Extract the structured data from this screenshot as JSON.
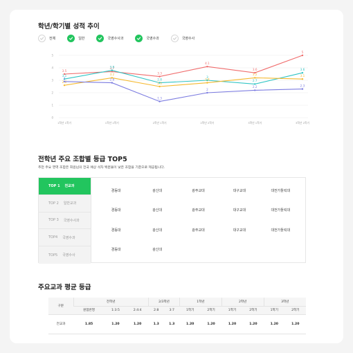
{
  "section1": {
    "title": "학년/학기별 성적 추이"
  },
  "filters": [
    {
      "label": "전체",
      "checked": false
    },
    {
      "label": "일반",
      "checked": true
    },
    {
      "label": "국영수사과",
      "checked": true
    },
    {
      "label": "국영수과",
      "checked": true
    },
    {
      "label": "국영수사",
      "checked": false
    }
  ],
  "chart_data": {
    "type": "line",
    "categories": [
      "1학년 1학기",
      "1학년 2학기",
      "2학년 1학기",
      "2학년 2학기",
      "3학년 1학기",
      "3학년 2학기"
    ],
    "ylim": [
      0,
      5
    ],
    "yticks": [
      0,
      1,
      2,
      3,
      4,
      5
    ],
    "ytick_labels": [
      "0",
      "1",
      "2",
      "3",
      "4",
      "5"
    ],
    "grid": true,
    "series": [
      {
        "color": "#f06c6c",
        "values": [
          3.5,
          3.7,
          3.3,
          4.1,
          3.6,
          5
        ],
        "labels": [
          "3.5",
          "3.7",
          "3.3",
          "4.1",
          "3.6",
          "5"
        ]
      },
      {
        "color": "#2ec4c4",
        "values": [
          3.1,
          3.8,
          2.8,
          3,
          2.7,
          3.6
        ],
        "labels": [
          "3.1",
          "3.8",
          "2.8",
          "3",
          "2.7",
          "3.6"
        ]
      },
      {
        "color": "#f5b82e",
        "values": [
          2.6,
          3.2,
          2.5,
          2.8,
          3.2,
          3.1
        ],
        "labels": [
          "2.6",
          "3.2",
          "2.5",
          "2.8",
          "3.2",
          "3.1"
        ]
      },
      {
        "color": "#7b7be0",
        "values": [
          2.9,
          2.8,
          1.3,
          2,
          2.2,
          2.3
        ],
        "labels": [
          "2",
          "2.8",
          "1.3",
          "2",
          "2.2",
          "2.3"
        ]
      }
    ]
  },
  "section2": {
    "title": "전학년 주요 조합별 등급 TOP5",
    "description": "추천 주요 영역 조합은 희원님의 전국 예상 석차 백분율이 낮은 조합을 기준으로 제공됩니다."
  },
  "top_tabs": [
    {
      "num": "TOP 1",
      "label": "전교과",
      "active": true
    },
    {
      "num": "TOP 2",
      "label": "일반교과",
      "active": false
    },
    {
      "num": "TOP 3",
      "label": "국영수사과",
      "active": false
    },
    {
      "num": "TOP4",
      "label": "국영수과",
      "active": false
    },
    {
      "num": "TOP5",
      "label": "국영수사",
      "active": false
    }
  ],
  "universities": [
    [
      "경동대",
      "광신대",
      "광주교대",
      "대구교대",
      "대전가톨릭대"
    ],
    [
      "경동대",
      "광신대",
      "광주교대",
      "대구교대",
      "대전가톨릭대"
    ],
    [
      "경동대",
      "광신대",
      "광주교대",
      "대구교대",
      "대전가톨릭대"
    ],
    [
      "경동대",
      "광신대"
    ]
  ],
  "section3": {
    "title": "주요교과 평균 등급"
  },
  "grade_table": {
    "row_header": "구분",
    "groups": [
      "전학년",
      "2/3학년",
      "1학년",
      "2학년",
      "3학년"
    ],
    "subheaders": [
      "원점반영",
      "1:3:5",
      "2:4:4",
      "2:8",
      "3:7",
      "1학기",
      "2학기",
      "1학기",
      "2학기",
      "1학기",
      "2학기"
    ],
    "rows": [
      {
        "label": "전교과",
        "values": [
          "1.85",
          "1.20",
          "1.20",
          "1.3",
          "1.3",
          "1.20",
          "1.20",
          "1.20",
          "1.20",
          "1.20",
          "1.20"
        ]
      }
    ]
  }
}
